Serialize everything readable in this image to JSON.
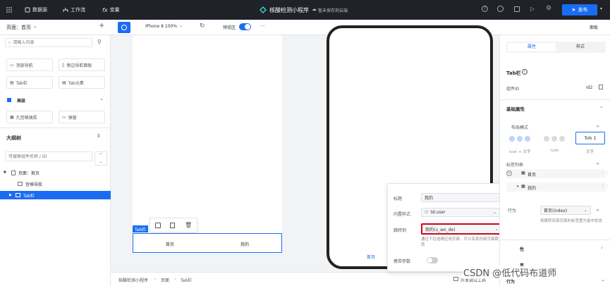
{
  "topbar": {
    "nav": [
      {
        "label": "数据源",
        "icon": "database-icon"
      },
      {
        "label": "工作流",
        "icon": "workflow-icon"
      },
      {
        "label": "变量",
        "icon": "function-icon"
      }
    ],
    "app_title": "核酸检测小程序",
    "save_status": "暂未保存到云端",
    "publish_label": "发布"
  },
  "subbar": {
    "page_label": "页面：首页",
    "device": "iPhone 8 100%",
    "preview_label": "预览区",
    "more": "···",
    "right_label": "面板"
  },
  "left": {
    "search_placeholder": "请输入内容",
    "components": [
      "顶部导航",
      "侧边导航面板",
      "Tab栏",
      "Tab元素"
    ],
    "advanced_title": "高级",
    "advanced": [
      "九宫格抽奖",
      "弹窗"
    ],
    "outline_title": "大纲树",
    "outline_search_placeholder": "可搜索组件名称 / ID",
    "tree": [
      {
        "label": "页面：首页",
        "level": 0
      },
      {
        "label": "宫格导航",
        "level": 1
      },
      {
        "label": "Tab栏",
        "level": 1,
        "selected": true
      }
    ]
  },
  "canvas": {
    "tab_tag": "Tab栏",
    "tabs": [
      "首页",
      "我的"
    ],
    "phone_tab": "首页",
    "breadcrumb": [
      "核酸检测小程序",
      "页面",
      "Tab栏"
    ],
    "devtools": "开发调试工具"
  },
  "popup": {
    "rows": [
      {
        "label": "标题",
        "value": "我的"
      },
      {
        "label": "内置样式",
        "value": "td:user"
      },
      {
        "label": "跳转到",
        "value": "我的(u_wo_de)"
      }
    ],
    "hint": "通过下拉选择应用页面，可以实现内部页面跳转",
    "param_label": "携带参数"
  },
  "right": {
    "tabs": [
      "属性",
      "样式"
    ],
    "component_title": "Tab栏",
    "id_label": "组件ID",
    "id_value": "id2",
    "basic_title": "基础属性",
    "layout_label": "布局模式",
    "layout_options": [
      "icon + 文字",
      "icon",
      "文字"
    ],
    "tab_btn": "Tob 1",
    "list_label": "标签列表",
    "list_items": [
      "首页",
      "我的"
    ],
    "page_select": "首页(index)",
    "page_hint": "将跳转到该页面的标签置为选中状态",
    "section_labels": [
      "性",
      "事",
      "行为"
    ]
  },
  "watermark": "CSDN @低代码布道师",
  "colors": {
    "accent": "#1a6cf3",
    "topbar": "#1f2329",
    "selected": "#1a6cf3",
    "red_border": "#d0021b"
  }
}
